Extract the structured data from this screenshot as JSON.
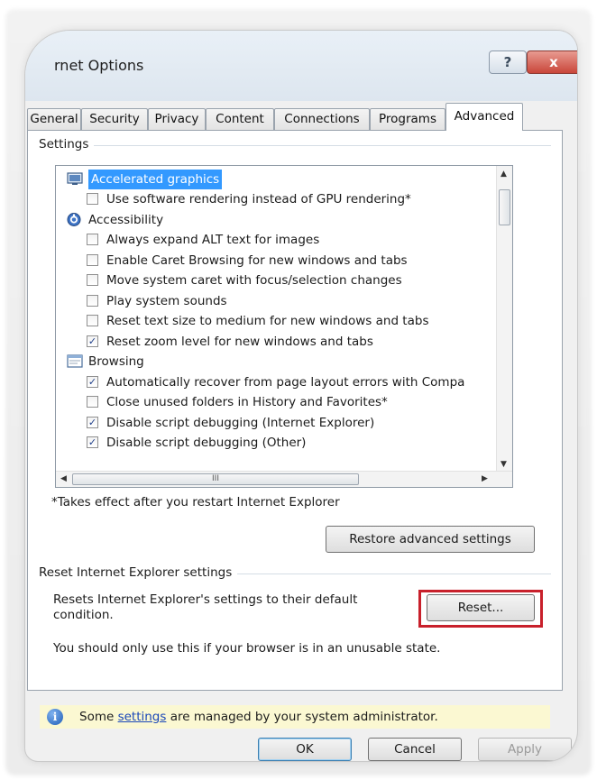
{
  "window": {
    "title": "rnet Options",
    "help_label": "?",
    "close_label": "x"
  },
  "tabs": [
    {
      "label": "General"
    },
    {
      "label": "Security"
    },
    {
      "label": "Privacy"
    },
    {
      "label": "Content"
    },
    {
      "label": "Connections"
    },
    {
      "label": "Programs"
    },
    {
      "label": "Advanced",
      "active": true
    }
  ],
  "settings": {
    "group_label": "Settings",
    "tree": [
      {
        "type": "category",
        "icon": "display-icon",
        "label": "Accelerated graphics",
        "selected": true
      },
      {
        "type": "option",
        "label": "Use software rendering instead of GPU rendering*",
        "checked": false
      },
      {
        "type": "category",
        "icon": "accessibility-icon",
        "label": "Accessibility"
      },
      {
        "type": "option",
        "label": "Always expand ALT text for images",
        "checked": false
      },
      {
        "type": "option",
        "label": "Enable Caret Browsing for new windows and tabs",
        "checked": false
      },
      {
        "type": "option",
        "label": "Move system caret with focus/selection changes",
        "checked": false
      },
      {
        "type": "option",
        "label": "Play system sounds",
        "checked": false
      },
      {
        "type": "option",
        "label": "Reset text size to medium for new windows and tabs",
        "checked": false
      },
      {
        "type": "option",
        "label": "Reset zoom level for new windows and tabs",
        "checked": true
      },
      {
        "type": "category",
        "icon": "browsing-icon",
        "label": "Browsing"
      },
      {
        "type": "option",
        "label": "Automatically recover from page layout errors with Compa",
        "checked": true
      },
      {
        "type": "option",
        "label": "Close unused folders in History and Favorites*",
        "checked": false
      },
      {
        "type": "option",
        "label": "Disable script debugging (Internet Explorer)",
        "checked": true
      },
      {
        "type": "option",
        "label": "Disable script debugging (Other)",
        "checked": true
      }
    ],
    "hscroll_grip": "III",
    "restart_note": "*Takes effect after you restart Internet Explorer",
    "restore_button": "Restore advanced settings"
  },
  "reset": {
    "group_label": "Reset Internet Explorer settings",
    "description": "Resets Internet Explorer's settings to their default condition.",
    "button": "Reset...",
    "warning": "You should only use this if your browser is in an unusable state."
  },
  "admin_notice": {
    "before": "Some ",
    "link": "settings",
    "after": " are managed by your system administrator."
  },
  "footer": {
    "ok": "OK",
    "cancel": "Cancel",
    "apply": "Apply"
  },
  "colors": {
    "selection": "#3399ff",
    "highlight_border": "#c8202b",
    "admin_bar": "#fbf8d2",
    "link": "#1a47b8"
  }
}
